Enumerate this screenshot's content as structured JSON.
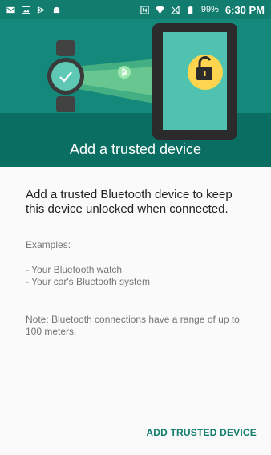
{
  "status_bar": {
    "battery_percent": "99%",
    "time": "6:30 PM",
    "left_icons": [
      "mail-icon",
      "gallery-icon",
      "play-store-icon",
      "android-icon"
    ],
    "right_icons": [
      "nfc-icon",
      "wifi-icon",
      "no-signal-icon",
      "battery-icon"
    ]
  },
  "hero": {
    "title": "Add a trusted device",
    "colors": {
      "top": "#14887a",
      "bottom": "#0b6e63",
      "watch": "#424242",
      "lock_badge": "#ffd54f",
      "beam": "#6ccf8a"
    }
  },
  "content": {
    "lead": "Add a trusted Bluetooth device to keep this device unlocked when connected.",
    "examples_label": "Examples:",
    "example_1": "- Your Bluetooth watch",
    "example_2": "- Your car's Bluetooth system",
    "note": "Note: Bluetooth connections have a range of up to 100 meters."
  },
  "actions": {
    "add_trusted_device": "ADD TRUSTED DEVICE"
  }
}
